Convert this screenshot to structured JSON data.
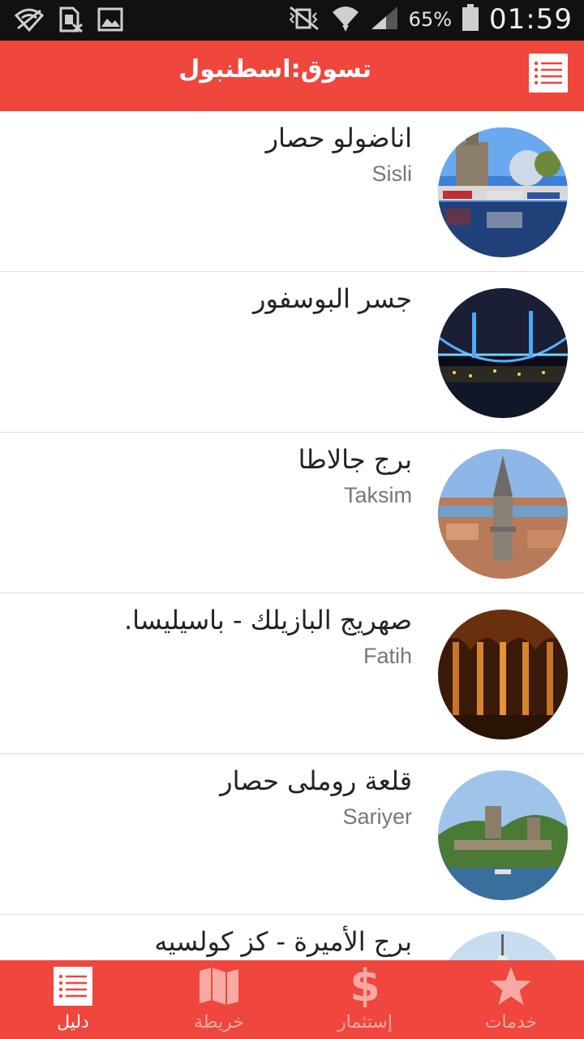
{
  "status_bar": {
    "battery_percent": "65%",
    "time": "01:59"
  },
  "app_bar": {
    "title": "تسوق:اسطنبول",
    "menu_icon": "list-icon"
  },
  "places": [
    {
      "title": "اناضولو حصار",
      "district": "Sisli"
    },
    {
      "title": "جسر البوسفور",
      "district": ""
    },
    {
      "title": "برج جالاطا",
      "district": "Taksim"
    },
    {
      "title": "صهريج البازيلك - باسيليسا.",
      "district": "Fatih"
    },
    {
      "title": "قلعة روملى حصار",
      "district": "Sariyer"
    },
    {
      "title": "برج الأميرة - كز كولسيه",
      "district": ""
    }
  ],
  "bottom_nav": {
    "items": [
      {
        "label": "دليل",
        "icon": "list-icon",
        "active": true
      },
      {
        "label": "خريطة",
        "icon": "map-icon",
        "active": false
      },
      {
        "label": "إستثمار",
        "icon": "dollar-icon",
        "active": false
      },
      {
        "label": "خدمات",
        "icon": "star-icon",
        "active": false
      }
    ]
  },
  "colors": {
    "accent": "#ef463d",
    "status_bar": "#111111",
    "nav_inactive": "#f7aaa4"
  }
}
